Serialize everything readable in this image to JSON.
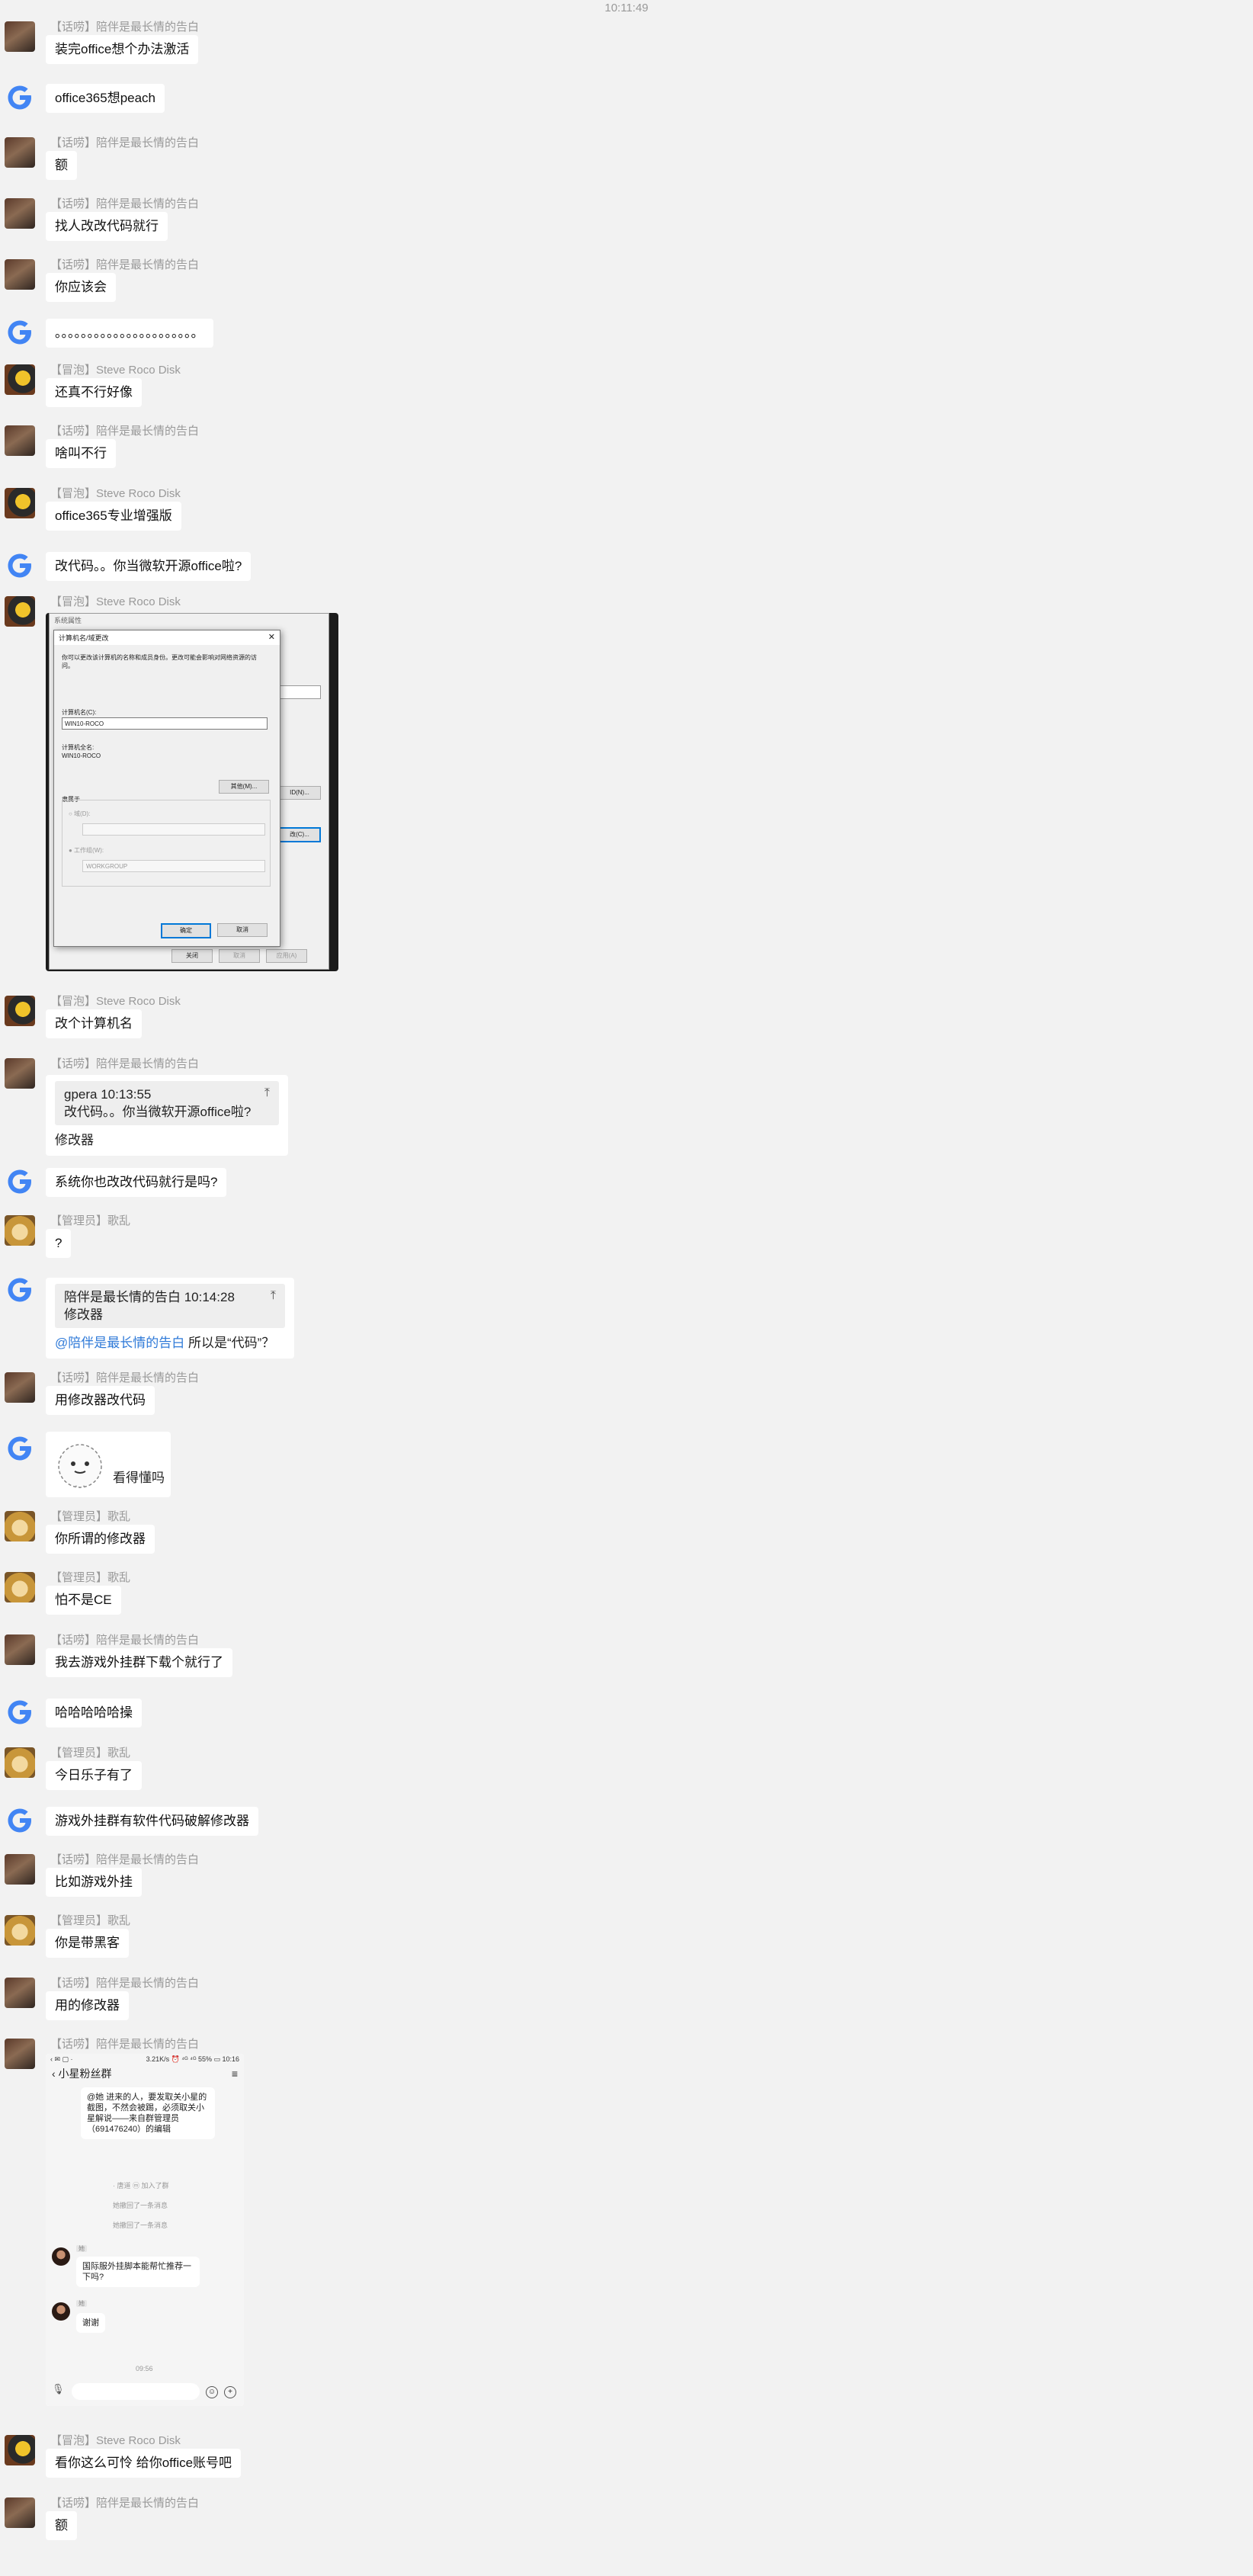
{
  "header": {
    "time": "10:11:49"
  },
  "names": {
    "user": "【话唠】陪伴是最长情的告白",
    "steve": "【冒泡】Steve Roco Disk",
    "admin": "【管理员】歌乱"
  },
  "messages": [
    {
      "who": "user",
      "text": "装完office想个办法激活"
    },
    {
      "who": "g",
      "text": "office365想peach"
    },
    {
      "who": "user",
      "text": "额"
    },
    {
      "who": "user",
      "text": "找人改改代码就行"
    },
    {
      "who": "user",
      "text": "你应该会"
    },
    {
      "who": "g",
      "text": "。。。。。。。。。。。。。。。。。。。。。。"
    },
    {
      "who": "steve",
      "text": "还真不行好像"
    },
    {
      "who": "user",
      "text": "啥叫不行"
    },
    {
      "who": "steve",
      "text": "office365专业增强版"
    },
    {
      "who": "g",
      "text": "改代码。。你当微软开源office啦?"
    },
    {
      "who": "steve",
      "text": "改个计算机名"
    },
    {
      "who": "g",
      "text": "系统你也改改代码就行是吗?"
    },
    {
      "who": "admin",
      "text": "?"
    },
    {
      "who": "user",
      "text": "用修改器改代码"
    },
    {
      "who": "admin",
      "text": "你所谓的修改器"
    },
    {
      "who": "admin",
      "text": "怕不是CE"
    },
    {
      "who": "user",
      "text": "我去游戏外挂群下载个就行了"
    },
    {
      "who": "g",
      "text": "哈哈哈哈哈操"
    },
    {
      "who": "admin",
      "text": "今日乐子有了"
    },
    {
      "who": "g",
      "text": "游戏外挂群有软件代码破解修改器"
    },
    {
      "who": "user",
      "text": "比如游戏外挂"
    },
    {
      "who": "admin",
      "text": "你是带黑客"
    },
    {
      "who": "user",
      "text": "用的修改器"
    },
    {
      "who": "steve",
      "text": "看你这么可怜 给你office账号吧"
    },
    {
      "who": "user",
      "text": "额"
    }
  ],
  "quote1": {
    "header": "gpera   10:13:55",
    "quoted": "改代码。。你当微软开源office啦?",
    "reply": "修改器",
    "pin": "⤒"
  },
  "quote2": {
    "header": "陪伴是最长情的告白   10:14:28",
    "quoted": "修改器",
    "mention": "@陪伴是最长情的告白",
    "reply": " 所以是“代码”？",
    "pin": "⤒"
  },
  "emoji_msg": {
    "caption": "看得懂吗",
    "face": "• ᴗ •"
  },
  "windows_dialog": {
    "outer_title": "系统属性",
    "title": "计算机名/域更改",
    "close": "✕",
    "desc": "你可以更改该计算机的名称和成员身份。更改可能会影响对网络资源的访问。",
    "computer_name_label": "计算机名(C):",
    "computer_name_value": "WIN10-ROCO",
    "full_name_label": "计算机全名:",
    "full_name_value": "WIN10-ROCO",
    "other_button": "其他(M)...",
    "member_of": "隶属于",
    "domain": "域(D):",
    "workgroup": "工作组(W):",
    "workgroup_value": "WORKGROUP",
    "ok": "确定",
    "cancel": "取消",
    "right_btn1": "ID(N)...",
    "right_btn2": "改(C)...",
    "bottom_ok": "关闭",
    "bottom_cancel": "取消",
    "bottom_apply": "应用(A)"
  },
  "phone_shot": {
    "status_left": "‹ ✉ ▢ ·",
    "status_right": "3.21K/s ⏰ ⁴ᴳ ⁴ᴳ 55% ▭ 10:16",
    "title": "‹ 小星粉丝群",
    "menu": "≡",
    "notice": "@她 进来的人，要发取关小星的截图，不然会被踢，必须取关小星解说——来自群管理员（691476240）的编辑",
    "sys1": "· 唐道 ⓜ 加入了群",
    "sys2": "她撤回了一条消息",
    "sys3": "她撤回了一条消息",
    "tag": "她",
    "msg1": "国际服外挂脚本能帮忙推荐一下吗?",
    "msg2": "谢谢",
    "time": "09:56",
    "mic": "🎙",
    "smile": "☺",
    "plus": "+"
  }
}
